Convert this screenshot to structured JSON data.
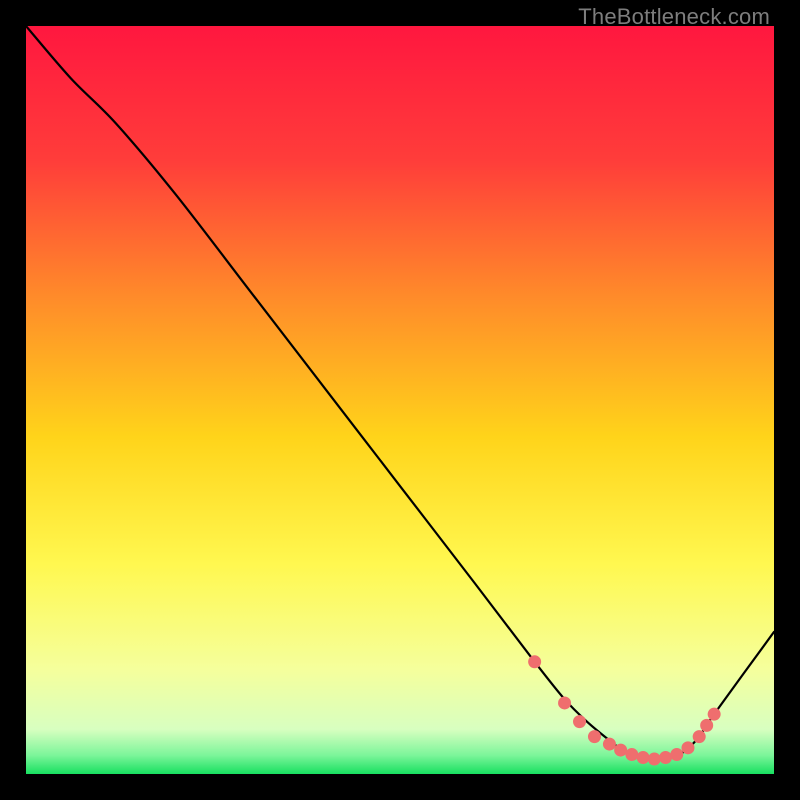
{
  "watermark": "TheBottleneck.com",
  "chart_data": {
    "type": "line",
    "title": "",
    "xlabel": "",
    "ylabel": "",
    "xlim": [
      0,
      100
    ],
    "ylim": [
      0,
      100
    ],
    "gradient_stops": [
      {
        "pos": 0.0,
        "color": "#ff173f"
      },
      {
        "pos": 0.18,
        "color": "#ff3d3a"
      },
      {
        "pos": 0.36,
        "color": "#ff8a2a"
      },
      {
        "pos": 0.55,
        "color": "#ffd41a"
      },
      {
        "pos": 0.72,
        "color": "#fff850"
      },
      {
        "pos": 0.86,
        "color": "#f5ff9c"
      },
      {
        "pos": 0.94,
        "color": "#d8ffc0"
      },
      {
        "pos": 0.975,
        "color": "#7cf59a"
      },
      {
        "pos": 1.0,
        "color": "#18e060"
      }
    ],
    "series": [
      {
        "name": "bottleneck-curve",
        "x": [
          0,
          6,
          12,
          20,
          30,
          40,
          50,
          60,
          68,
          72,
          75,
          78,
          80,
          82,
          84,
          86,
          88,
          90,
          92,
          100
        ],
        "y": [
          100,
          93,
          87,
          77.5,
          64.5,
          51.5,
          38.5,
          25.5,
          15,
          10,
          7,
          4.5,
          3,
          2.3,
          2,
          2.3,
          3,
          5,
          8,
          19
        ],
        "stroke": "#000000",
        "stroke_width": 2.2
      }
    ],
    "markers": {
      "name": "marker-dots",
      "fill": "#ef6e6e",
      "radius": 6.5,
      "points": [
        {
          "x": 68,
          "y": 15
        },
        {
          "x": 72,
          "y": 9.5
        },
        {
          "x": 74,
          "y": 7
        },
        {
          "x": 76,
          "y": 5
        },
        {
          "x": 78,
          "y": 4
        },
        {
          "x": 79.5,
          "y": 3.2
        },
        {
          "x": 81,
          "y": 2.6
        },
        {
          "x": 82.5,
          "y": 2.2
        },
        {
          "x": 84,
          "y": 2
        },
        {
          "x": 85.5,
          "y": 2.2
        },
        {
          "x": 87,
          "y": 2.6
        },
        {
          "x": 88.5,
          "y": 3.5
        },
        {
          "x": 90,
          "y": 5
        },
        {
          "x": 91,
          "y": 6.5
        },
        {
          "x": 92,
          "y": 8
        }
      ]
    }
  }
}
